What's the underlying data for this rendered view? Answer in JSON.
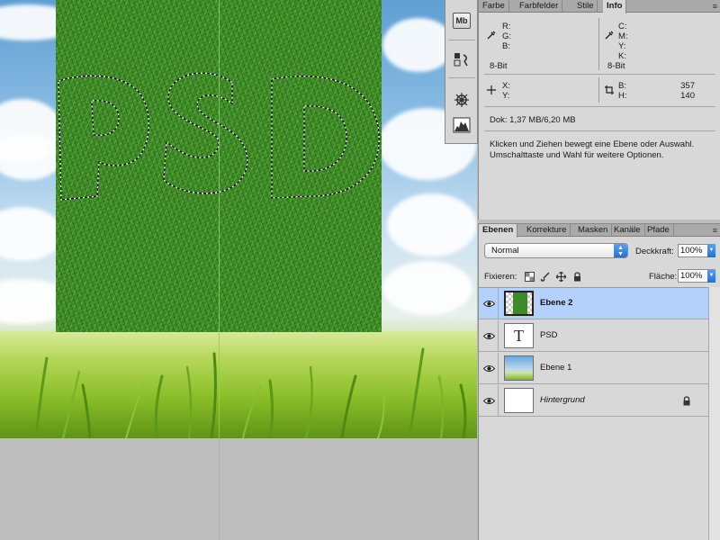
{
  "canvas": {
    "artwork_text": "PSD",
    "colors": {
      "grass": "#3f8f28",
      "sky": "#8fc0e6",
      "guide": "#5fd0c8",
      "pasteboard": "#bebebe"
    }
  },
  "icon_strip": {
    "icons": [
      "mini-bridge-icon",
      "history-icon",
      "navigator-icon",
      "histogram-icon"
    ],
    "mb_label": "Mb"
  },
  "info_panel": {
    "tabs": [
      {
        "label": "Farbe",
        "active": false
      },
      {
        "label": "Farbfelder",
        "active": false
      },
      {
        "label": "Stile",
        "active": false
      },
      {
        "label": "Info",
        "active": true
      }
    ],
    "rgb": {
      "r": "R:",
      "g": "G:",
      "b": "B:",
      "bitdepth": "8-Bit"
    },
    "cmyk": {
      "c": "C:",
      "m": "M:",
      "y": "Y:",
      "k": "K:",
      "bitdepth": "8-Bit"
    },
    "position": {
      "x": "X:",
      "y": "Y:"
    },
    "size": {
      "b_label": "B:",
      "h_label": "H:",
      "b_value": "357",
      "h_value": "140"
    },
    "doc": "Dok: 1,37 MB/6,20 MB",
    "hint_line1": "Klicken und Ziehen bewegt eine Ebene oder Auswahl.",
    "hint_line2": "Umschalttaste und Wahl für weitere Optionen."
  },
  "layers_panel": {
    "tabs": [
      {
        "label": "Ebenen",
        "active": true
      },
      {
        "label": "Korrekture",
        "active": false
      },
      {
        "label": "Masken",
        "active": false
      },
      {
        "label": "Kanäle",
        "active": false
      },
      {
        "label": "Pfade",
        "active": false
      }
    ],
    "blend_mode": "Normal",
    "opacity_label": "Deckkraft:",
    "opacity_value": "100%",
    "lock_label": "Fixieren:",
    "fill_label": "Fläche:",
    "fill_value": "100%",
    "thumb_text_glyph": "T",
    "layers": [
      {
        "name": "Ebene 2",
        "type": "texture",
        "selected": true,
        "locked": false
      },
      {
        "name": "PSD",
        "type": "text",
        "selected": false,
        "locked": false
      },
      {
        "name": "Ebene 1",
        "type": "image",
        "selected": false,
        "locked": false
      },
      {
        "name": "Hintergrund",
        "type": "background",
        "selected": false,
        "locked": true
      }
    ]
  }
}
